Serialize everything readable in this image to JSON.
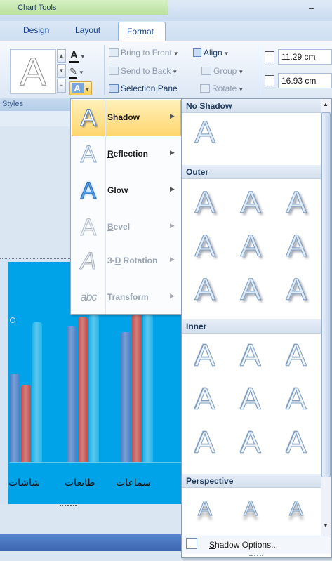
{
  "window": {
    "context_tab": "Chart Tools",
    "minimize_glyph": "–"
  },
  "tabs": [
    {
      "label": "Design"
    },
    {
      "label": "Layout"
    },
    {
      "label": "Format",
      "active": true
    }
  ],
  "ribbon": {
    "wordart_style_glyph": "A",
    "group_label": "Styles",
    "text_fill_glyph": "A",
    "text_effects_glyph": "A",
    "arrange": {
      "bring_to_front": "Bring to Front",
      "send_to_back": "Send to Back",
      "selection_pane": "Selection Pane",
      "align": "Align",
      "group": "Group",
      "rotate": "Rotate"
    },
    "size": {
      "height": "11.29 cm",
      "width": "16.93 cm"
    }
  },
  "effects_menu": {
    "items": [
      {
        "label": "Shadow",
        "accel": "S",
        "rest": "hadow",
        "enabled": true,
        "selected": true
      },
      {
        "label": "Reflection",
        "accel": "R",
        "rest": "eflection",
        "enabled": true
      },
      {
        "label": "Glow",
        "accel": "G",
        "rest": "low",
        "enabled": true
      },
      {
        "label": "Bevel",
        "accel": "B",
        "rest": "evel",
        "enabled": false
      },
      {
        "label": "3-D Rotation",
        "pre": "3-",
        "accel": "D",
        "rest": " Rotation",
        "enabled": false
      },
      {
        "label": "Transform",
        "accel": "T",
        "rest": "ransform",
        "enabled": false
      }
    ]
  },
  "shadow_gallery": {
    "sections": {
      "none": "No Shadow",
      "outer": "Outer",
      "inner": "Inner",
      "perspective": "Perspective"
    },
    "cell_glyph": "A",
    "options_label": "Shadow Options...",
    "options_accel": "S",
    "options_rest": "hadow Options..."
  },
  "chart_data": {
    "type": "bar",
    "categories": [
      "شاشات",
      "طابعات",
      "سماعات"
    ],
    "series": [
      {
        "values": [
          60,
          92,
          88
        ],
        "color": "#4a7ec6"
      },
      {
        "values": [
          52,
          98,
          100
        ],
        "color": "#c0504d"
      },
      {
        "values": [
          95,
          100,
          100
        ],
        "color": "#23b3e8"
      }
    ],
    "background": "#00a3e8"
  },
  "colors": {
    "accent": "#ffd66f",
    "ribbon_blue": "#15428b",
    "context_green": "#b9df9c"
  }
}
